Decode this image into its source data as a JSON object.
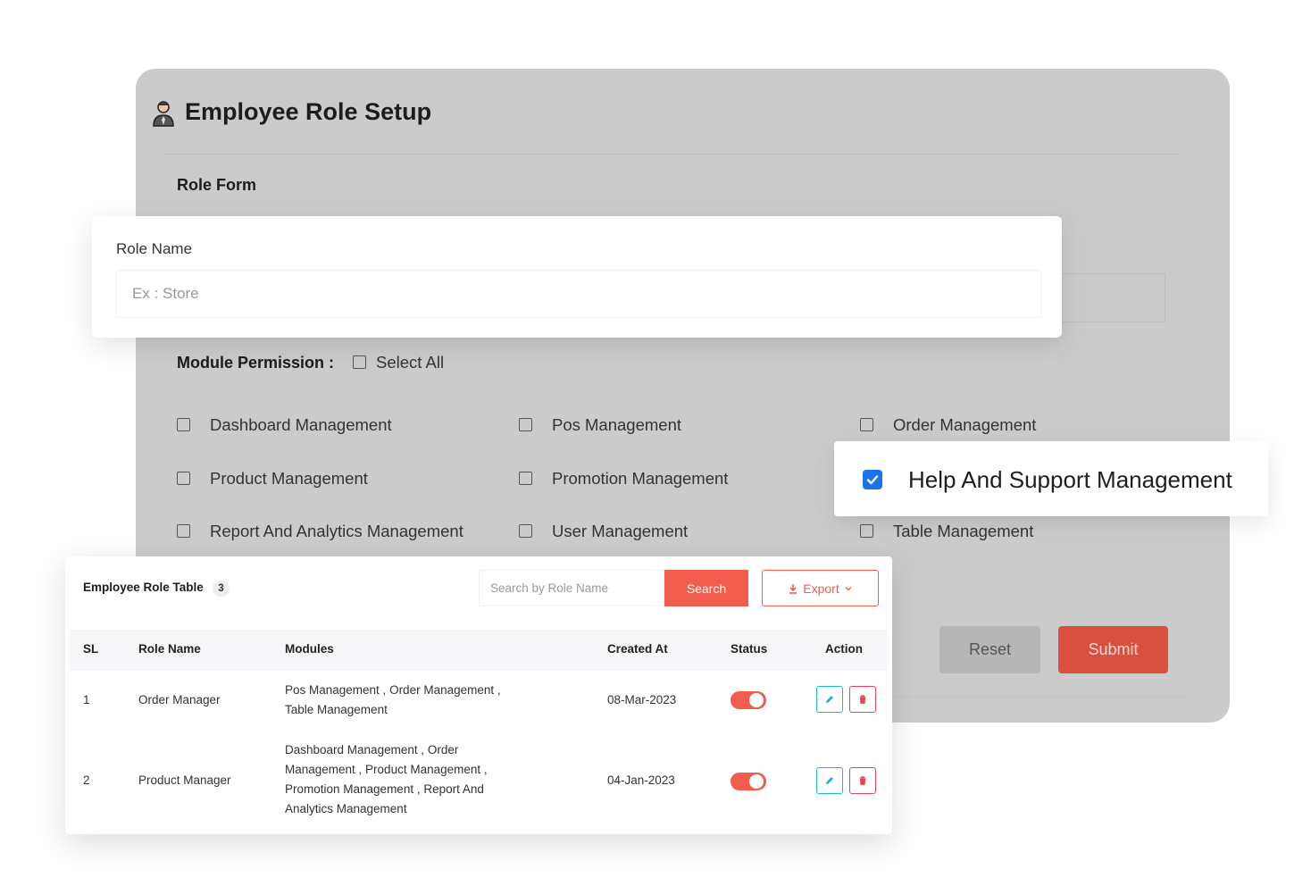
{
  "background": {
    "title": "Employee Role Setup",
    "role_form_heading": "Role Form",
    "module_permission_label": "Module Permission :",
    "select_all_label": "Select All",
    "modules": [
      {
        "label": "Dashboard Management",
        "checked": false
      },
      {
        "label": "Pos Management",
        "checked": false
      },
      {
        "label": "Order Management",
        "checked": false
      },
      {
        "label": "Product Management",
        "checked": false
      },
      {
        "label": "Promotion Management",
        "checked": false
      },
      {
        "label": "Report And Analytics Management",
        "checked": false
      },
      {
        "label": "User Management",
        "checked": false
      },
      {
        "label": "Table Management",
        "checked": false
      }
    ],
    "reset_label": "Reset",
    "submit_label": "Submit"
  },
  "role_card": {
    "label": "Role Name",
    "placeholder": "Ex : Store",
    "value": ""
  },
  "help_card": {
    "label": "Help And Support Management",
    "checked": true
  },
  "table": {
    "title": "Employee Role Table",
    "count": "3",
    "search_placeholder": "Search by Role Name",
    "search_button": "Search",
    "export_button": "Export",
    "headers": [
      "SL",
      "Role Name",
      "Modules",
      "Created At",
      "Status",
      "Action"
    ],
    "rows": [
      {
        "sl": "1",
        "role_name": "Order Manager",
        "modules": "Pos Management , Order Management , Table Management",
        "created_at": "08-Mar-2023",
        "status": true
      },
      {
        "sl": "2",
        "role_name": "Product Manager",
        "modules": "Dashboard Management , Order Management , Product Management , Promotion Management , Report And Analytics Management",
        "created_at": "04-Jan-2023",
        "status": true
      }
    ]
  },
  "colors": {
    "accent": "#f25c4c",
    "edit": "#1eb7c8",
    "delete": "#e8435a",
    "check": "#1a73e8"
  }
}
